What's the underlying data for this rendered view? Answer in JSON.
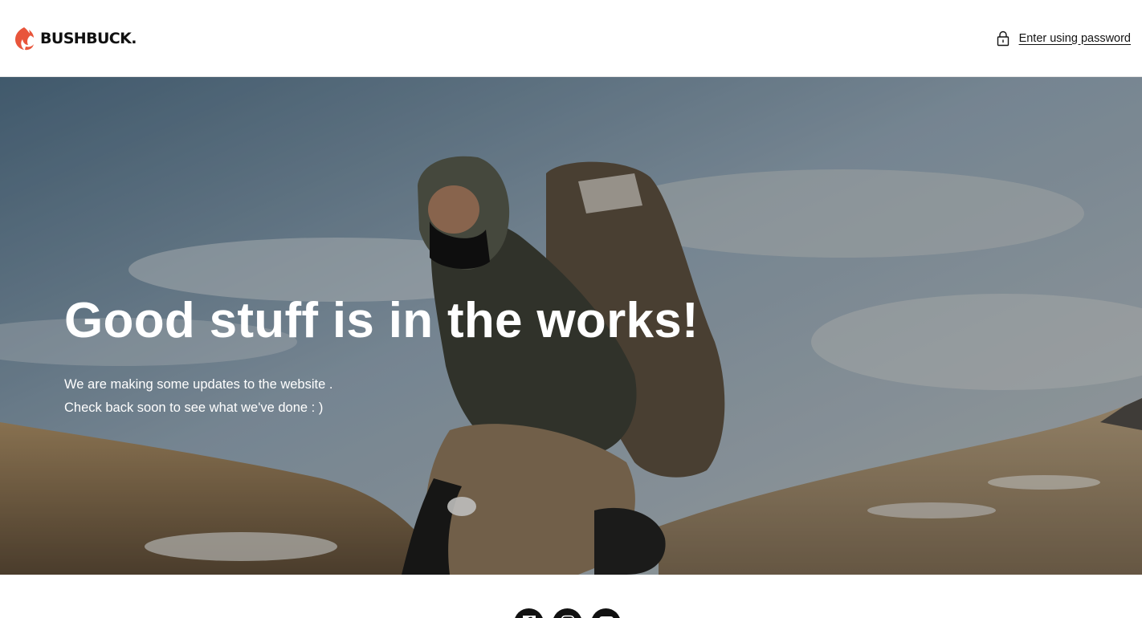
{
  "header": {
    "brand_name": "BUSHBUCK.",
    "password_link": "Enter using password"
  },
  "hero": {
    "title": "Good stuff is in the works!",
    "lines": [
      "We are making some updates to the website .",
      "Check back soon to see what we've done : )"
    ]
  },
  "footer": {
    "social_icons": [
      "facebook-icon",
      "instagram-icon",
      "youtube-icon"
    ]
  },
  "colors": {
    "brand_accent": "#e8553b",
    "text": "#121212",
    "background": "#ffffff"
  }
}
